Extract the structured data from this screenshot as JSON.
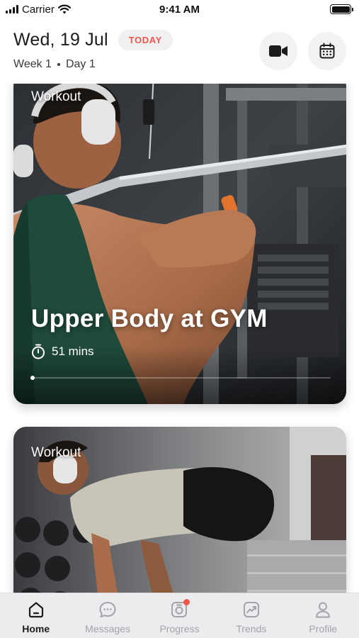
{
  "status_bar": {
    "carrier": "Carrier",
    "time": "9:41 AM"
  },
  "header": {
    "date": "Wed, 19 Jul",
    "today_badge": "TODAY",
    "week": "Week 1",
    "day": "Day 1",
    "video_icon": "video-camera-icon",
    "calendar_icon": "calendar-icon"
  },
  "colors": {
    "accent": "#f1584c",
    "tab_active": "#1c1c1e",
    "tab_inactive": "#a3a3a8"
  },
  "workouts": [
    {
      "label": "Workout",
      "title": "Upper Body at GYM",
      "duration": "51 mins",
      "progress": 0.0
    },
    {
      "label": "Workout"
    }
  ],
  "tabs": [
    {
      "label": "Home",
      "icon": "home-icon",
      "active": true
    },
    {
      "label": "Messages",
      "icon": "chat-icon",
      "active": false
    },
    {
      "label": "Progress",
      "icon": "camera-icon",
      "active": false,
      "notification": true
    },
    {
      "label": "Trends",
      "icon": "trend-chart-icon",
      "active": false
    },
    {
      "label": "Profile",
      "icon": "user-icon",
      "active": false
    }
  ]
}
